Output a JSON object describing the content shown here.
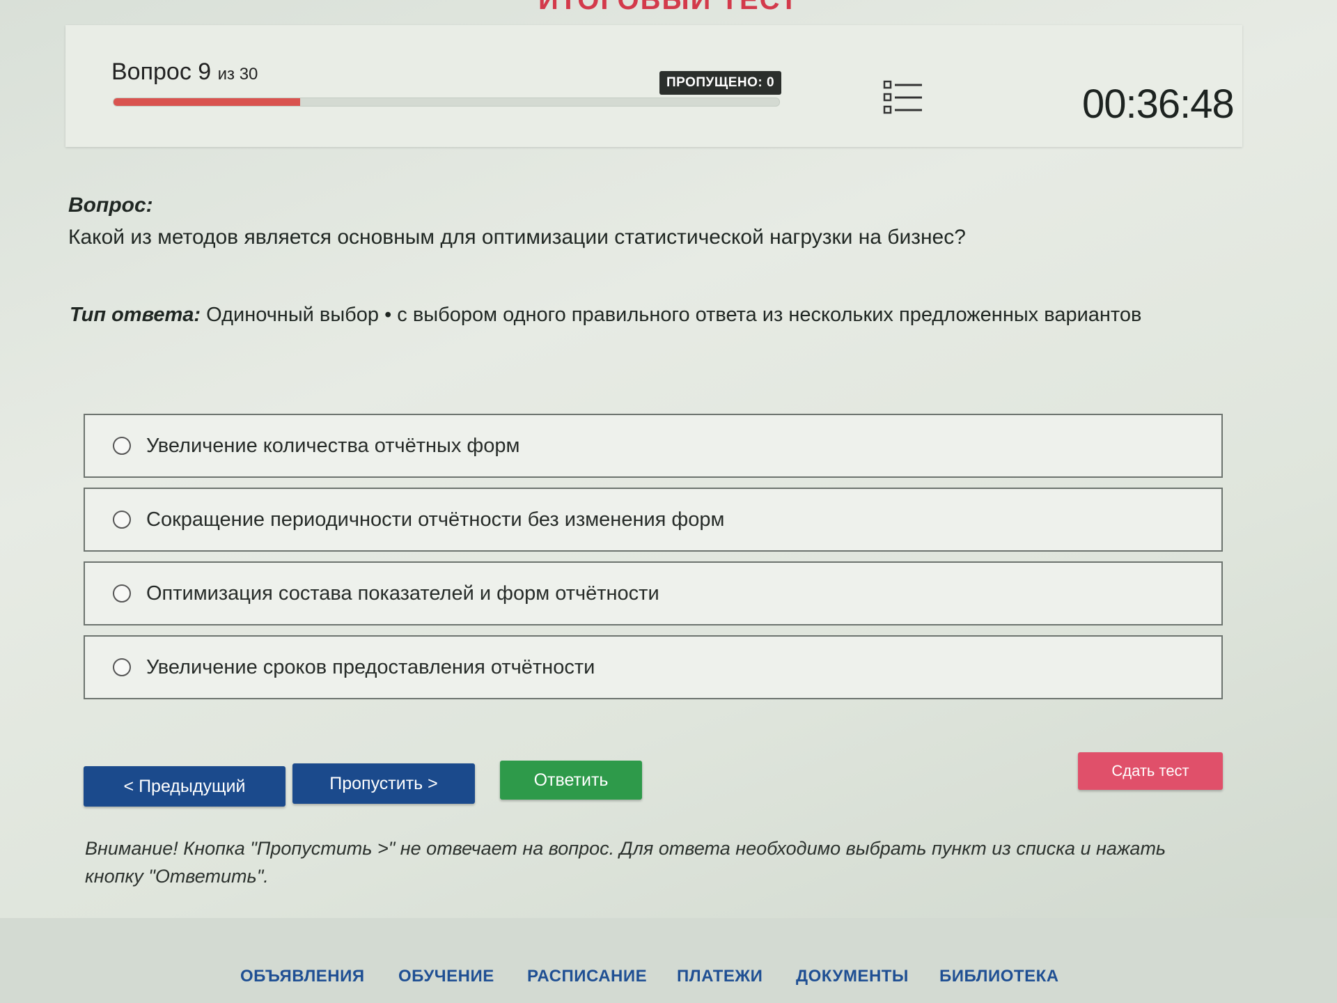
{
  "page": {
    "heading": "ИТОГОВЫЙ ТЕСТ"
  },
  "header": {
    "question_word": "Вопрос 9",
    "question_total": "из 30",
    "progress": 0.28,
    "skipped_label": "ПРОПУЩЕНО: 0",
    "timer": "00:36:48"
  },
  "question": {
    "label": "Вопрос:",
    "text": "Какой из методов является основным для оптимизации статистической нагрузки на бизнес?",
    "type_label": "Тип ответа:",
    "type_text": " Одиночный выбор • с выбором одного правильного ответа из нескольких предложенных вариантов"
  },
  "options": [
    "Увеличение количества отчётных форм",
    "Сокращение периодичности отчётности без изменения форм",
    "Оптимизация состава показателей и форм отчётности",
    "Увеличение сроков предоставления отчётности"
  ],
  "buttons": {
    "prev": "< Предыдущий",
    "skip": "Пропустить >",
    "answer": "Ответить",
    "submit": "Сдать тест"
  },
  "warning": "Внимание! Кнопка \"Пропустить >\" не отвечает на вопрос. Для ответа необходимо выбрать пункт из списка и нажать кнопку \"Ответить\".",
  "footer_nav": [
    "ОБЪЯВЛЕНИЯ",
    "ОБУЧЕНИЕ",
    "РАСПИСАНИЕ",
    "ПЛАТЕЖИ",
    "ДОКУМЕНТЫ",
    "БИБЛИОТЕКА"
  ],
  "colors": {
    "primary_blue": "#1b4a8c",
    "answer_green": "#2e9a4a",
    "submit_red": "#e0506a",
    "progress_red": "#d9534f"
  }
}
